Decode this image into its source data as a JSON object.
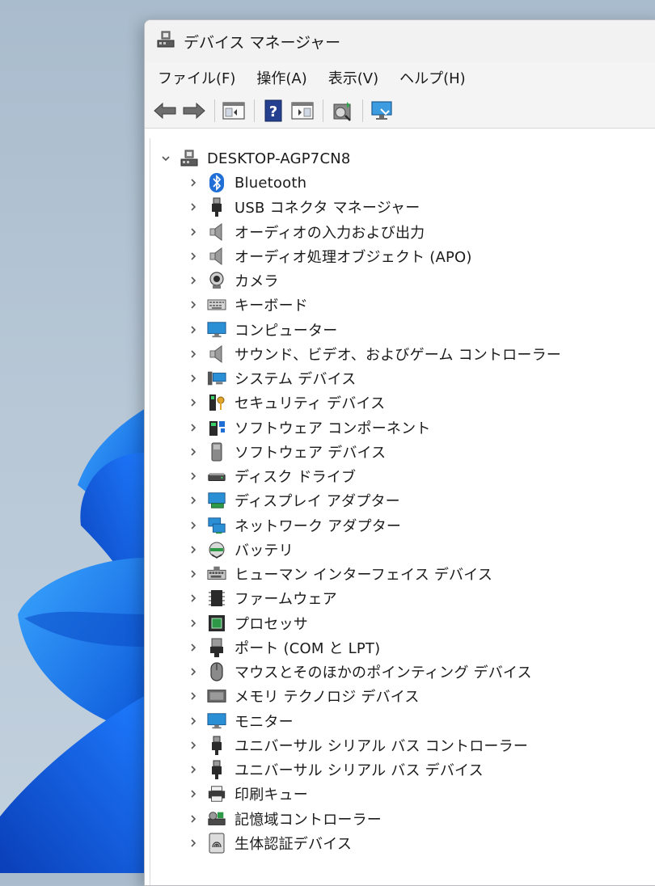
{
  "window": {
    "title": "デバイス マネージャー"
  },
  "menu": [
    {
      "label": "ファイル(F)"
    },
    {
      "label": "操作(A)"
    },
    {
      "label": "表示(V)"
    },
    {
      "label": "ヘルプ(H)"
    }
  ],
  "toolbar": {
    "buttons": [
      {
        "icon": "back-arrow-icon"
      },
      {
        "icon": "forward-arrow-icon"
      },
      {
        "icon": "show-hide-console-tree-icon"
      },
      {
        "icon": "help-icon"
      },
      {
        "icon": "show-hide-action-pane-icon"
      },
      {
        "icon": "scan-hardware-icon"
      },
      {
        "icon": "monitor-properties-icon"
      }
    ]
  },
  "tree": {
    "root": {
      "label": "DESKTOP-AGP7CN8",
      "icon": "computer-network-icon",
      "expanded": true
    },
    "items": [
      {
        "label": "Bluetooth",
        "icon": "bluetooth-icon"
      },
      {
        "label": "USB コネクタ マネージャー",
        "icon": "usb-plug-icon"
      },
      {
        "label": "オーディオの入力および出力",
        "icon": "speaker-icon"
      },
      {
        "label": "オーディオ処理オブジェクト (APO)",
        "icon": "speaker-icon"
      },
      {
        "label": "カメラ",
        "icon": "webcam-icon"
      },
      {
        "label": "キーボード",
        "icon": "keyboard-icon"
      },
      {
        "label": "コンピューター",
        "icon": "monitor-icon"
      },
      {
        "label": "サウンド、ビデオ、およびゲーム コントローラー",
        "icon": "speaker-icon"
      },
      {
        "label": "システム デバイス",
        "icon": "system-device-icon"
      },
      {
        "label": "セキュリティ デバイス",
        "icon": "security-key-icon"
      },
      {
        "label": "ソフトウェア コンポーネント",
        "icon": "software-component-icon"
      },
      {
        "label": "ソフトウェア デバイス",
        "icon": "software-device-icon"
      },
      {
        "label": "ディスク ドライブ",
        "icon": "disk-drive-icon"
      },
      {
        "label": "ディスプレイ アダプター",
        "icon": "display-adapter-icon"
      },
      {
        "label": "ネットワーク アダプター",
        "icon": "network-adapter-icon"
      },
      {
        "label": "バッテリ",
        "icon": "battery-icon"
      },
      {
        "label": "ヒューマン インターフェイス デバイス",
        "icon": "hid-icon"
      },
      {
        "label": "ファームウェア",
        "icon": "firmware-chip-icon"
      },
      {
        "label": "プロセッサ",
        "icon": "processor-icon"
      },
      {
        "label": "ポート (COM と LPT)",
        "icon": "port-icon"
      },
      {
        "label": "マウスとそのほかのポインティング デバイス",
        "icon": "mouse-icon"
      },
      {
        "label": "メモリ テクノロジ デバイス",
        "icon": "memory-icon"
      },
      {
        "label": "モニター",
        "icon": "monitor-icon"
      },
      {
        "label": "ユニバーサル シリアル バス コントローラー",
        "icon": "usb-plug-icon"
      },
      {
        "label": "ユニバーサル シリアル バス デバイス",
        "icon": "usb-plug-icon"
      },
      {
        "label": "印刷キュー",
        "icon": "printer-icon"
      },
      {
        "label": "記憶域コントローラー",
        "icon": "storage-controller-icon"
      },
      {
        "label": "生体認証デバイス",
        "icon": "fingerprint-icon"
      }
    ]
  },
  "colors": {
    "window_bg": "#ffffff",
    "chrome_bg": "#f4f4f4",
    "text": "#1b1b1b",
    "bluetooth": "#1f6fd6",
    "monitor": "#2b8fd6"
  }
}
